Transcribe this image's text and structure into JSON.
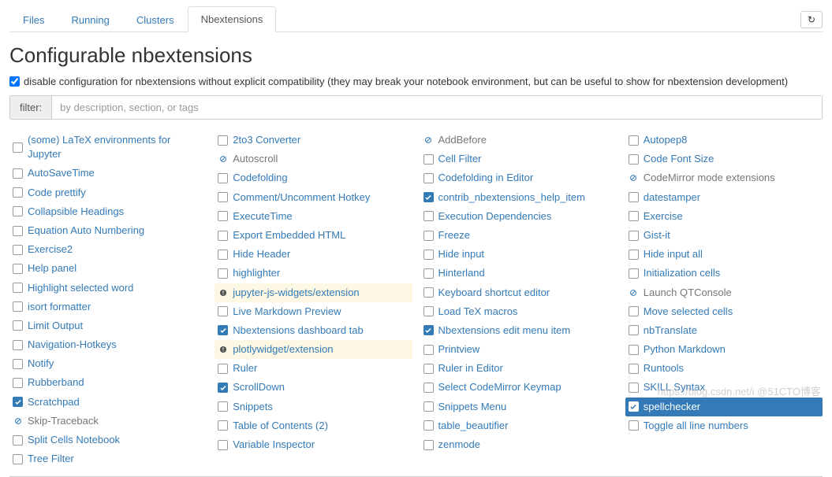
{
  "tabs": [
    {
      "label": "Files"
    },
    {
      "label": "Running"
    },
    {
      "label": "Clusters"
    },
    {
      "label": "Nbextensions",
      "active": true
    }
  ],
  "refresh_glyph": "↻",
  "page_title": "Configurable nbextensions",
  "compat_checkbox_label": "disable configuration for nbextensions without explicit compatibility (they may break your notebook environment, but can be useful to show for nbextension development)",
  "filter": {
    "label": "filter:",
    "placeholder": "by description, section, or tags"
  },
  "columns": [
    [
      {
        "label": "(some) LaTeX environments for Jupyter",
        "state": "unchecked"
      },
      {
        "label": "AutoSaveTime",
        "state": "unchecked"
      },
      {
        "label": "Code prettify",
        "state": "unchecked"
      },
      {
        "label": "Collapsible Headings",
        "state": "unchecked"
      },
      {
        "label": "Equation Auto Numbering",
        "state": "unchecked"
      },
      {
        "label": "Exercise2",
        "state": "unchecked"
      },
      {
        "label": "Help panel",
        "state": "unchecked"
      },
      {
        "label": "Highlight selected word",
        "state": "unchecked"
      },
      {
        "label": "isort formatter",
        "state": "unchecked"
      },
      {
        "label": "Limit Output",
        "state": "unchecked"
      },
      {
        "label": "Navigation-Hotkeys",
        "state": "unchecked"
      },
      {
        "label": "Notify",
        "state": "unchecked"
      },
      {
        "label": "Rubberband",
        "state": "unchecked"
      },
      {
        "label": "Scratchpad",
        "state": "checked"
      },
      {
        "label": "Skip-Traceback",
        "state": "forbidden"
      },
      {
        "label": "Split Cells Notebook",
        "state": "unchecked"
      },
      {
        "label": "Tree Filter",
        "state": "unchecked"
      }
    ],
    [
      {
        "label": "2to3 Converter",
        "state": "unchecked"
      },
      {
        "label": "Autoscroll",
        "state": "forbidden"
      },
      {
        "label": "Codefolding",
        "state": "unchecked"
      },
      {
        "label": "Comment/Uncomment Hotkey",
        "state": "unchecked"
      },
      {
        "label": "ExecuteTime",
        "state": "unchecked"
      },
      {
        "label": "Export Embedded HTML",
        "state": "unchecked"
      },
      {
        "label": "Hide Header",
        "state": "unchecked"
      },
      {
        "label": "highlighter",
        "state": "unchecked"
      },
      {
        "label": "jupyter-js-widgets/extension",
        "state": "warning"
      },
      {
        "label": "Live Markdown Preview",
        "state": "unchecked"
      },
      {
        "label": "Nbextensions dashboard tab",
        "state": "checked"
      },
      {
        "label": "plotlywidget/extension",
        "state": "warning"
      },
      {
        "label": "Ruler",
        "state": "unchecked"
      },
      {
        "label": "ScrollDown",
        "state": "checked"
      },
      {
        "label": "Snippets",
        "state": "unchecked"
      },
      {
        "label": "Table of Contents (2)",
        "state": "unchecked"
      },
      {
        "label": "Variable Inspector",
        "state": "unchecked"
      }
    ],
    [
      {
        "label": "AddBefore",
        "state": "forbidden"
      },
      {
        "label": "Cell Filter",
        "state": "unchecked"
      },
      {
        "label": "Codefolding in Editor",
        "state": "unchecked"
      },
      {
        "label": "contrib_nbextensions_help_item",
        "state": "checked"
      },
      {
        "label": "Execution Dependencies",
        "state": "unchecked"
      },
      {
        "label": "Freeze",
        "state": "unchecked"
      },
      {
        "label": "Hide input",
        "state": "unchecked"
      },
      {
        "label": "Hinterland",
        "state": "unchecked"
      },
      {
        "label": "Keyboard shortcut editor",
        "state": "unchecked"
      },
      {
        "label": "Load TeX macros",
        "state": "unchecked"
      },
      {
        "label": "Nbextensions edit menu item",
        "state": "checked"
      },
      {
        "label": "Printview",
        "state": "unchecked"
      },
      {
        "label": "Ruler in Editor",
        "state": "unchecked"
      },
      {
        "label": "Select CodeMirror Keymap",
        "state": "unchecked"
      },
      {
        "label": "Snippets Menu",
        "state": "unchecked"
      },
      {
        "label": "table_beautifier",
        "state": "unchecked"
      },
      {
        "label": "zenmode",
        "state": "unchecked"
      }
    ],
    [
      {
        "label": "Autopep8",
        "state": "unchecked"
      },
      {
        "label": "Code Font Size",
        "state": "unchecked"
      },
      {
        "label": "CodeMirror mode extensions",
        "state": "forbidden"
      },
      {
        "label": "datestamper",
        "state": "unchecked"
      },
      {
        "label": "Exercise",
        "state": "unchecked"
      },
      {
        "label": "Gist-it",
        "state": "unchecked"
      },
      {
        "label": "Hide input all",
        "state": "unchecked"
      },
      {
        "label": "Initialization cells",
        "state": "unchecked"
      },
      {
        "label": "Launch QTConsole",
        "state": "forbidden"
      },
      {
        "label": "Move selected cells",
        "state": "unchecked"
      },
      {
        "label": "nbTranslate",
        "state": "unchecked"
      },
      {
        "label": "Python Markdown",
        "state": "unchecked"
      },
      {
        "label": "Runtools",
        "state": "unchecked"
      },
      {
        "label": "SKILL Syntax",
        "state": "unchecked"
      },
      {
        "label": "spellchecker",
        "state": "checked",
        "selected": true
      },
      {
        "label": "Toggle all line numbers",
        "state": "unchecked"
      }
    ]
  ],
  "watermark": "https://blog.csdn.net/i @51CTO博客"
}
